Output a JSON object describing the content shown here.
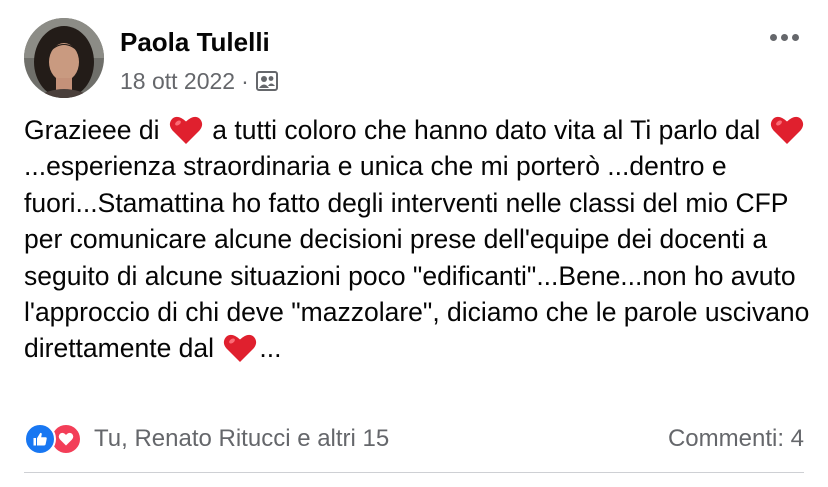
{
  "post": {
    "author": "Paola Tulelli",
    "date": "18 ott 2022",
    "separator": "·",
    "audience_icon": "friends-audience-icon",
    "body_segments": [
      {
        "type": "text",
        "value": "Grazieee di "
      },
      {
        "type": "emoji",
        "value": "red-heart"
      },
      {
        "type": "text",
        "value": " a tutti coloro che hanno dato vita al Ti parlo dal "
      },
      {
        "type": "emoji",
        "value": "red-heart"
      },
      {
        "type": "text",
        "value": "...esperienza straordinaria e unica che mi porterò ...dentro e fuori...Stamattina ho fatto degli interventi nelle classi del mio CFP per comunicare alcune decisioni prese dell'equipe dei docenti a seguito di alcune situazioni poco \"edificanti\"...Bene...non ho avuto l'approccio di chi deve \"mazzolare\", diciamo che le parole uscivano direttamente dal "
      },
      {
        "type": "emoji",
        "value": "red-heart"
      },
      {
        "type": "text",
        "value": "..."
      }
    ]
  },
  "footer": {
    "reactors": "Tu, Renato Ritucci e altri 15",
    "comments": "Commenti: 4",
    "reaction_icons": [
      "like-icon",
      "love-icon"
    ]
  },
  "colors": {
    "like": "#1877f2",
    "love": "#f33e58",
    "secondary_text": "#65676b",
    "heart": "#e0202e"
  }
}
